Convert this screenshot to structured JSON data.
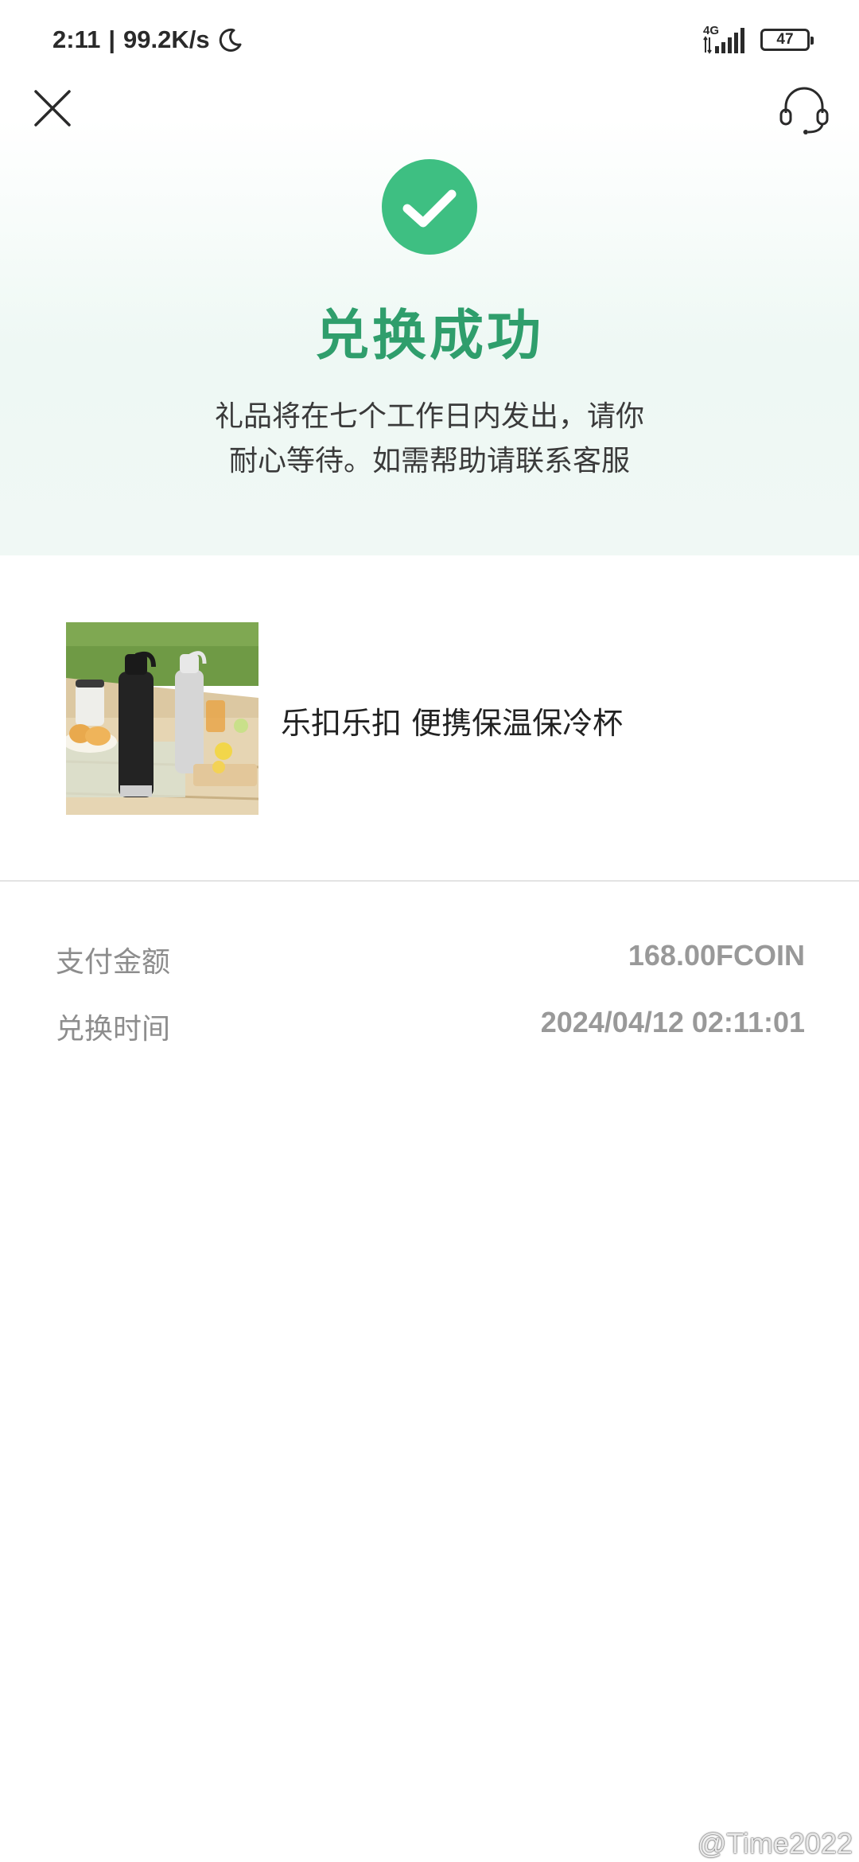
{
  "status_bar": {
    "time": "2:11",
    "separator": "|",
    "speed": "99.2K/s",
    "network": "4G",
    "battery": "47"
  },
  "header": {
    "close_icon": "close-icon",
    "support_icon": "headset-icon"
  },
  "success": {
    "icon": "check-circle-icon",
    "title": "兑换成功",
    "message_line1": "礼品将在七个工作日内发出，请你",
    "message_line2": "耐心等待。如需帮助请联系客服"
  },
  "product": {
    "name": "乐扣乐扣 便携保温保冷杯"
  },
  "details": {
    "amount_label": "支付金额",
    "amount_value": "168.00FCOIN",
    "time_label": "兑换时间",
    "time_value": "2024/04/12 02:11:01"
  },
  "watermark": "@Time2022",
  "colors": {
    "accent": "#2f9e6c",
    "check_circle": "#3ebf82",
    "muted_text": "#8d8d8d"
  }
}
